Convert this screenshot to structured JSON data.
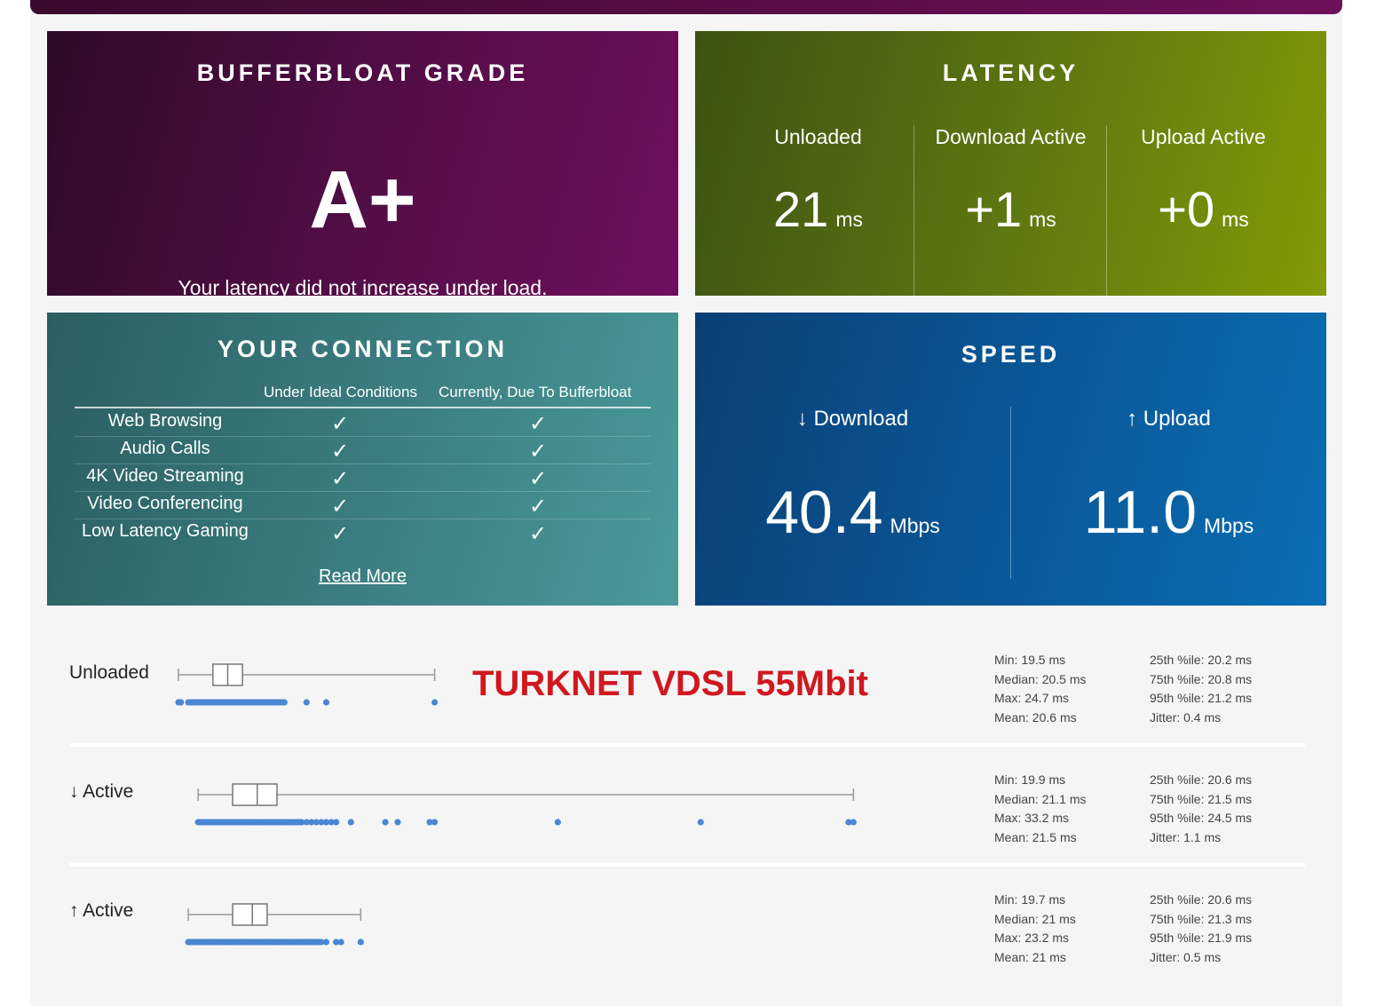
{
  "grade": {
    "title": "BUFFERBLOAT GRADE",
    "grade": "A+",
    "description": "Your latency did not increase under load."
  },
  "latency": {
    "title": "LATENCY",
    "columns": [
      {
        "label": "Unloaded",
        "value": "21",
        "unit": "ms"
      },
      {
        "label": "Download Active",
        "value": "+1",
        "unit": "ms"
      },
      {
        "label": "Upload Active",
        "value": "+0",
        "unit": "ms"
      }
    ]
  },
  "connection": {
    "title": "YOUR CONNECTION",
    "col_ideal": "Under Ideal Conditions",
    "col_current": "Currently, Due To Bufferbloat",
    "check_glyph": "✓",
    "rows": [
      {
        "name": "Web Browsing",
        "ideal": true,
        "current": true
      },
      {
        "name": "Audio Calls",
        "ideal": true,
        "current": true
      },
      {
        "name": "4K Video Streaming",
        "ideal": true,
        "current": true
      },
      {
        "name": "Video Conferencing",
        "ideal": true,
        "current": true
      },
      {
        "name": "Low Latency Gaming",
        "ideal": true,
        "current": true
      }
    ],
    "read_more": "Read More"
  },
  "speed": {
    "title": "SPEED",
    "download": {
      "label": "↓ Download",
      "value": "40.4",
      "unit": "Mbps"
    },
    "upload": {
      "label": "↑ Upload",
      "value": "11.0",
      "unit": "Mbps"
    }
  },
  "annotation": "TURKNET VDSL 55Mbit",
  "latency_plots": [
    {
      "label": "Unloaded",
      "min": 19.5,
      "q1": 20.2,
      "median": 20.5,
      "q3": 20.8,
      "max": 24.7,
      "samples": [
        19.5,
        19.55,
        19.7,
        19.75,
        19.8,
        19.85,
        19.9,
        19.95,
        20.0,
        20.05,
        20.1,
        20.15,
        20.2,
        20.25,
        20.3,
        20.35,
        20.4,
        20.45,
        20.5,
        20.55,
        20.6,
        20.65,
        20.7,
        20.75,
        20.8,
        20.85,
        20.9,
        20.95,
        21.0,
        21.05,
        21.1,
        21.15,
        21.2,
        21.25,
        21.3,
        21.35,
        21.4,
        21.45,
        21.5,
        21.55,
        21.6,
        21.65,
        22.1,
        22.5,
        24.7
      ],
      "stats_left": [
        "Min: 19.5 ms",
        "Median: 20.5 ms",
        "Max: 24.7 ms",
        "Mean: 20.6 ms"
      ],
      "stats_right": [
        "25th %ile: 20.2 ms",
        "75th %ile: 20.8 ms",
        "95th %ile: 21.2 ms",
        "Jitter: 0.4 ms"
      ]
    },
    {
      "label": "↓ Active",
      "min": 19.9,
      "q1": 20.6,
      "median": 21.1,
      "q3": 21.5,
      "max": 33.2,
      "samples": [
        19.9,
        19.95,
        20.0,
        20.05,
        20.1,
        20.15,
        20.2,
        20.25,
        20.3,
        20.35,
        20.4,
        20.45,
        20.5,
        20.55,
        20.6,
        20.65,
        20.7,
        20.75,
        20.8,
        20.85,
        20.9,
        20.95,
        21.0,
        21.05,
        21.1,
        21.15,
        21.2,
        21.25,
        21.3,
        21.35,
        21.4,
        21.45,
        21.5,
        21.55,
        21.6,
        21.65,
        21.7,
        21.75,
        21.8,
        21.85,
        21.9,
        21.95,
        22.0,
        22.1,
        22.2,
        22.3,
        22.4,
        22.5,
        22.6,
        22.7,
        23.0,
        23.7,
        23.95,
        24.6,
        24.7,
        27.2,
        30.1,
        33.1,
        33.2
      ],
      "stats_left": [
        "Min: 19.9 ms",
        "Median: 21.1 ms",
        "Max: 33.2 ms",
        "Mean: 21.5 ms"
      ],
      "stats_right": [
        "25th %ile: 20.6 ms",
        "75th %ile: 21.5 ms",
        "95th %ile: 24.5 ms",
        "Jitter: 1.1 ms"
      ]
    },
    {
      "label": "↑ Active",
      "min": 19.7,
      "q1": 20.6,
      "median": 21.0,
      "q3": 21.3,
      "max": 23.2,
      "samples": [
        19.7,
        19.75,
        19.8,
        19.85,
        19.9,
        19.95,
        20.0,
        20.05,
        20.1,
        20.15,
        20.2,
        20.25,
        20.3,
        20.35,
        20.4,
        20.45,
        20.5,
        20.55,
        20.6,
        20.65,
        20.7,
        20.75,
        20.8,
        20.85,
        20.9,
        20.95,
        21.0,
        21.05,
        21.1,
        21.15,
        21.2,
        21.25,
        21.3,
        21.35,
        21.4,
        21.45,
        21.5,
        21.55,
        21.6,
        21.65,
        21.7,
        21.75,
        21.8,
        21.85,
        21.9,
        21.95,
        22.0,
        22.05,
        22.1,
        22.15,
        22.2,
        22.25,
        22.3,
        22.35,
        22.4,
        22.5,
        22.7,
        22.8,
        23.2
      ],
      "stats_left": [
        "Min: 19.7 ms",
        "Median: 21 ms",
        "Max: 23.2 ms",
        "Mean: 21 ms"
      ],
      "stats_right": [
        "25th %ile: 20.6 ms",
        "75th %ile: 21.3 ms",
        "95th %ile: 21.9 ms",
        "Jitter: 0.5 ms"
      ]
    }
  ],
  "colors": {
    "dot": "#4a86d4",
    "whisker": "#9a9a9a",
    "annotation": "#d0181f"
  }
}
